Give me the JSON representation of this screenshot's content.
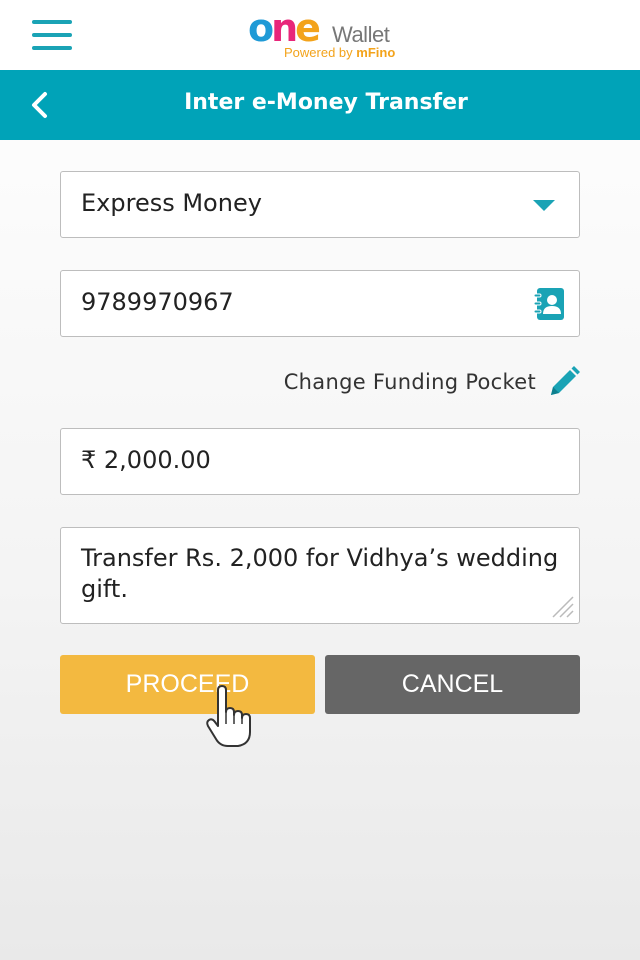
{
  "app": {
    "logo_main": "one",
    "logo_wallet": "Wallet",
    "logo_powered_prefix": "Powered by ",
    "logo_powered_brand": "mFino",
    "colors": {
      "primary": "#00a3b8",
      "proceed": "#f3b940",
      "cancel": "#666666"
    }
  },
  "header": {
    "title": "Inter e-Money Transfer",
    "back_icon": "chevron-left-icon",
    "menu_icon": "hamburger-menu-icon"
  },
  "form": {
    "provider": {
      "value": "Express Money",
      "icon": "caret-down-icon"
    },
    "mobile": {
      "value": "9789970967",
      "icon": "contact-book-icon"
    },
    "funding": {
      "label": "Change Funding Pocket",
      "icon": "pencil-icon"
    },
    "amount": {
      "value": "₹ 2,000.00"
    },
    "note": {
      "value": "Transfer Rs. 2,000 for Vidhya’s wedding gift."
    }
  },
  "actions": {
    "proceed_label": "PROCEED",
    "cancel_label": "CANCEL"
  }
}
